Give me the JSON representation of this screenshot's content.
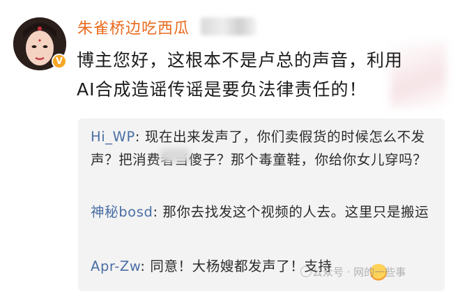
{
  "post": {
    "username": "朱雀桥边吃西瓜",
    "verified_badge": "V",
    "comment_lines": [
      "博主您好，这根本不是卢总的声音，利用",
      "AI合成造谣传谣是要负法律责任的！"
    ]
  },
  "replies": [
    {
      "name": "Hi_WP",
      "text": "现在出来发声了，你们卖假货的时候怎么不发声？把消费者当傻子？那个毒童鞋，你给你女儿穿吗？"
    },
    {
      "name": "神秘bosd",
      "text": "那你去找发这个视频的人去。这里只是搬运"
    },
    {
      "name": "Apr-Zw",
      "text": "同意！大杨嫂都发声了！支持"
    }
  ],
  "watermark": "公众号 · 网的一些事",
  "colors": {
    "username": "#e86a1c",
    "reply_name": "#4a6fa5",
    "reply_bg": "#f3f3f3"
  }
}
